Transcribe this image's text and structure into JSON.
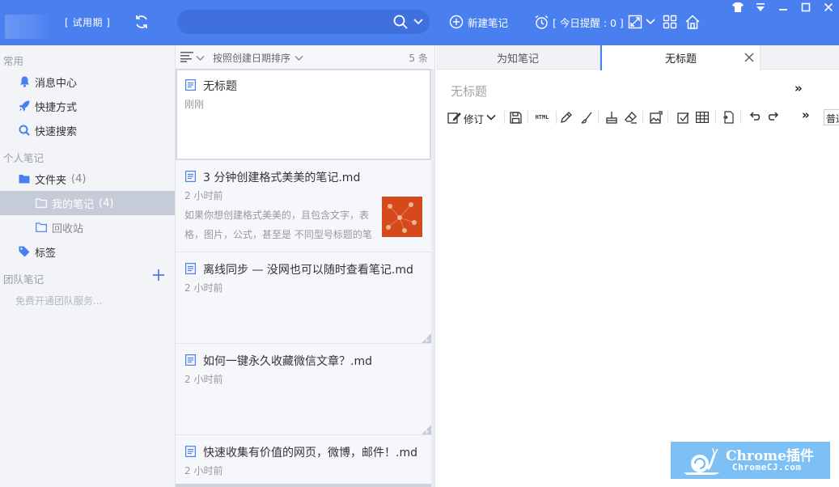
{
  "topbar": {
    "trial_label": "[ 试用期 ]",
    "search_placeholder": "",
    "new_note_label": "新建笔记",
    "reminder_label": "[ 今日提醒 : 0 ]"
  },
  "sidebar": {
    "section_common": "常用",
    "items_common": [
      {
        "label": "消息中心",
        "icon": "bell-icon"
      },
      {
        "label": "快捷方式",
        "icon": "rocket-icon"
      },
      {
        "label": "快速搜索",
        "icon": "search-icon"
      }
    ],
    "section_personal": "个人笔记",
    "folder": {
      "label": "文件夹",
      "count": "(4)"
    },
    "my_notes": {
      "label": "我的笔记",
      "count": "(4)"
    },
    "recycle": {
      "label": "回收站"
    },
    "tags": {
      "label": "标签"
    },
    "section_team": "团队笔记",
    "team_hint": "免费开通团队服务..."
  },
  "note_list": {
    "sort_label": "按照创建日期排序",
    "count_label": "5 条",
    "notes": [
      {
        "title": "无标题",
        "time": "刚刚",
        "summary": ""
      },
      {
        "title": "3 分钟创建格式美美的笔记.md",
        "time": "2 小时前",
        "summary": "如果你想创建格式美美的，且包含文字，表格，图片，公式，甚至是 不同型号标题的笔记..."
      },
      {
        "title": "离线同步 — 没网也可以随时查看笔记.md",
        "time": "2 小时前",
        "summary": ""
      },
      {
        "title": "如何一键永久收藏微信文章？.md",
        "time": "2 小时前",
        "summary": ""
      },
      {
        "title": "快速收集有价值的网页，微博，邮件！.md",
        "time": "2 小时前",
        "summary": ""
      }
    ]
  },
  "editor": {
    "tabs": [
      {
        "label": "为知笔记"
      },
      {
        "label": "无标题"
      }
    ],
    "title_placeholder": "无标题",
    "more_label": "»",
    "revise_label": "修订",
    "html_label": "HTML",
    "more_tools_label": "»",
    "normal_label": "普通"
  },
  "watermark": {
    "title": "Chrome插件",
    "subtitle": "ChromeCJ.com"
  },
  "colors": {
    "accent": "#4a7ff0",
    "sidebar_bg": "#f2f4f8",
    "active_item": "#c5ccd8",
    "note_icon": "#4a7ff0"
  }
}
